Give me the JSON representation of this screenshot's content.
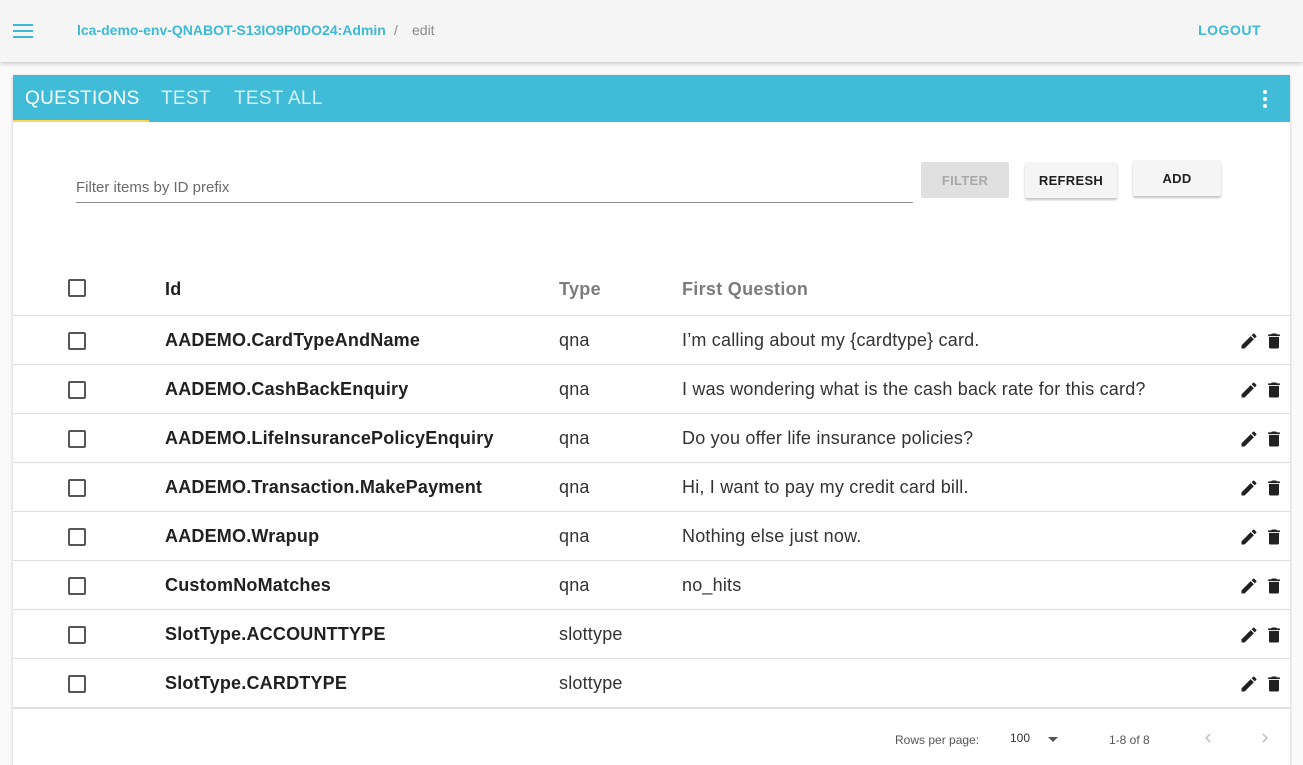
{
  "topbar": {
    "breadcrumb_env": "lca-demo-env-QNABOT-S13IO9P0DO24:Admin",
    "breadcrumb_sep": "/",
    "breadcrumb_page": "edit",
    "logout_label": "LOGOUT"
  },
  "tabs": [
    {
      "label": "QUESTIONS",
      "active": true
    },
    {
      "label": "TEST",
      "active": false
    },
    {
      "label": "TEST ALL",
      "active": false
    }
  ],
  "filter": {
    "placeholder": "Filter items by ID prefix",
    "value": "",
    "filter_label": "FILTER",
    "refresh_label": "REFRESH",
    "add_label": "ADD"
  },
  "table": {
    "headers": {
      "id": "Id",
      "type": "Type",
      "question": "First Question"
    },
    "rows": [
      {
        "id": "AADEMO.CardTypeAndName",
        "type": "qna",
        "question": "I’m calling about my {cardtype} card."
      },
      {
        "id": "AADEMO.CashBackEnquiry",
        "type": "qna",
        "question": "I was wondering what is the cash back rate for this card?"
      },
      {
        "id": "AADEMO.LifeInsurancePolicyEnquiry",
        "type": "qna",
        "question": "Do you offer life insurance policies?"
      },
      {
        "id": "AADEMO.Transaction.MakePayment",
        "type": "qna",
        "question": "Hi, I want to pay my credit card bill."
      },
      {
        "id": "AADEMO.Wrapup",
        "type": "qna",
        "question": "Nothing else just now."
      },
      {
        "id": "CustomNoMatches",
        "type": "qna",
        "question": "no_hits"
      },
      {
        "id": "SlotType.ACCOUNTTYPE",
        "type": "slottype",
        "question": ""
      },
      {
        "id": "SlotType.CARDTYPE",
        "type": "slottype",
        "question": ""
      }
    ]
  },
  "pagination": {
    "rows_per_page_label": "Rows per page:",
    "rows_per_page": "100",
    "range": "1-8 of 8"
  },
  "colors": {
    "accent": "#40bcd8",
    "link": "#3db9d6",
    "tab_indicator": "#ffd54f"
  },
  "icons": [
    "menu-icon",
    "more-vert-icon",
    "edit-icon",
    "delete-icon",
    "chevron-down-icon",
    "chevron-left-icon",
    "chevron-right-icon"
  ]
}
